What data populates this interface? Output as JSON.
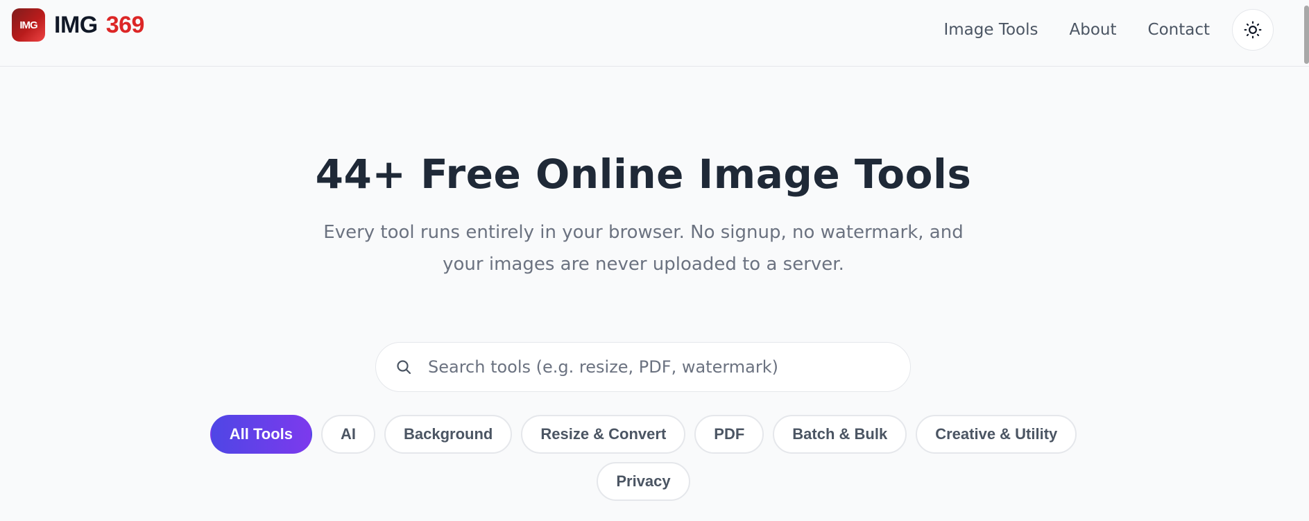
{
  "header": {
    "logo_badge": "IMG",
    "logo_word_img": "IMG",
    "logo_word_num": "369",
    "nav": [
      "Image Tools",
      "About",
      "Contact"
    ],
    "theme_toggle_icon": "sun-icon"
  },
  "hero": {
    "title": "44+ Free Online Image Tools",
    "subtitle_line1": "Every tool runs entirely in your browser. No signup, no watermark, and",
    "subtitle_line2": "your images are never uploaded to a server."
  },
  "search": {
    "placeholder": "Search tools (e.g. resize, PDF, watermark)",
    "value": "",
    "icon": "search-icon"
  },
  "filters": {
    "active": "All Tools",
    "items": [
      "All Tools",
      "AI",
      "Background",
      "Resize & Convert",
      "PDF",
      "Batch & Bulk",
      "Creative & Utility",
      "Privacy"
    ]
  },
  "colors": {
    "brand_red": "#dc2626",
    "accent_start": "#4f46e5",
    "accent_end": "#7c3aed",
    "page_bg": "#f9fafb"
  }
}
